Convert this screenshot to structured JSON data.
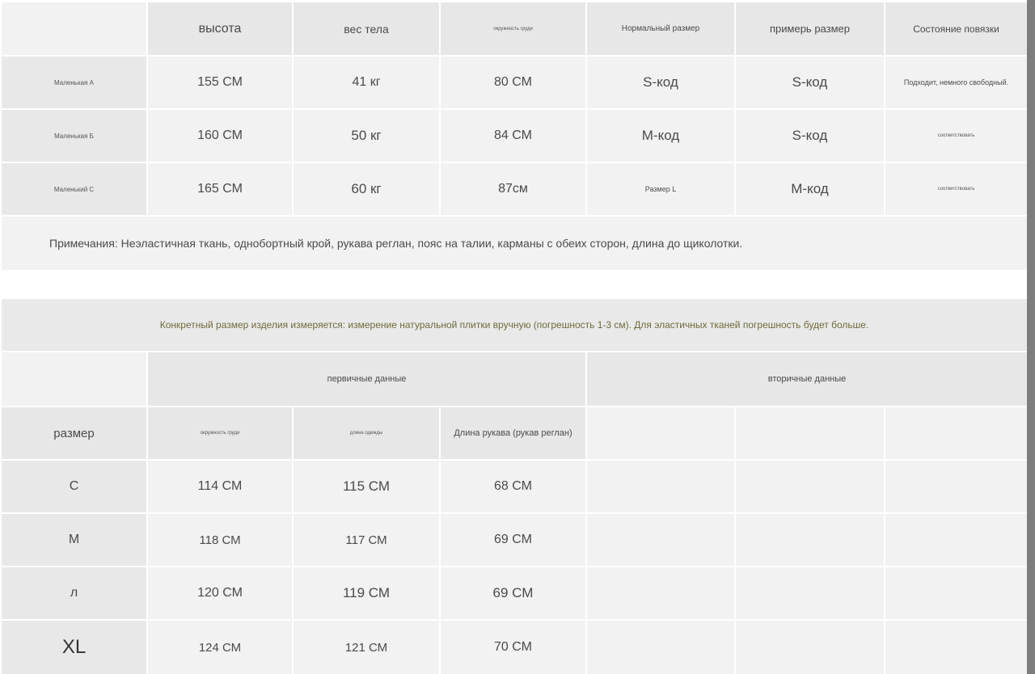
{
  "table1": {
    "headers": [
      "высота",
      "вес тела",
      "окружность груди",
      "Нормальный размер",
      "примерь размер",
      "Состояние повязки"
    ],
    "rows": [
      {
        "label": "Маленькая А",
        "cells": [
          "155 СМ",
          "41 кг",
          "80 СМ",
          "S-код",
          "S-код",
          "Подходит, немного свободный."
        ]
      },
      {
        "label": "Маленькая Б",
        "cells": [
          "160 СМ",
          "50 кг",
          "84 СМ",
          "М-код",
          "S-код",
          "соответствовать"
        ]
      },
      {
        "label": "Маленький С",
        "cells": [
          "165 СМ",
          "60 кг",
          "87см",
          "Размер L",
          "М-код",
          "соответствовать"
        ]
      }
    ],
    "note": "Примечания: Неэластичная ткань, однобортный крой, рукава реглан, пояс на талии, карманы с обеих сторон, длина до щиколотки."
  },
  "banner": "Конкретный размер изделия измеряется: измерение натуральной плитки вручную (погрешность 1-3 см). Для эластичных тканей погрешность будет больше.",
  "table2": {
    "group_primary": "первичные данные",
    "group_secondary": "вторичные данные",
    "size_header": "размер",
    "headers": [
      "окружность груди",
      "длина одежды",
      "Длина рукава (рукав реглан)"
    ],
    "rows": [
      {
        "size": "С",
        "cells": [
          "114 СМ",
          "115 СМ",
          "68 СМ"
        ]
      },
      {
        "size": "М",
        "cells": [
          "118 СМ",
          "117 СМ",
          "69 СМ"
        ]
      },
      {
        "size": "л",
        "cells": [
          "120 СМ",
          "119 СМ",
          "69 СМ"
        ]
      },
      {
        "size": "XL",
        "cells": [
          "124 СМ",
          "121 СМ",
          "70 СМ"
        ]
      }
    ]
  }
}
